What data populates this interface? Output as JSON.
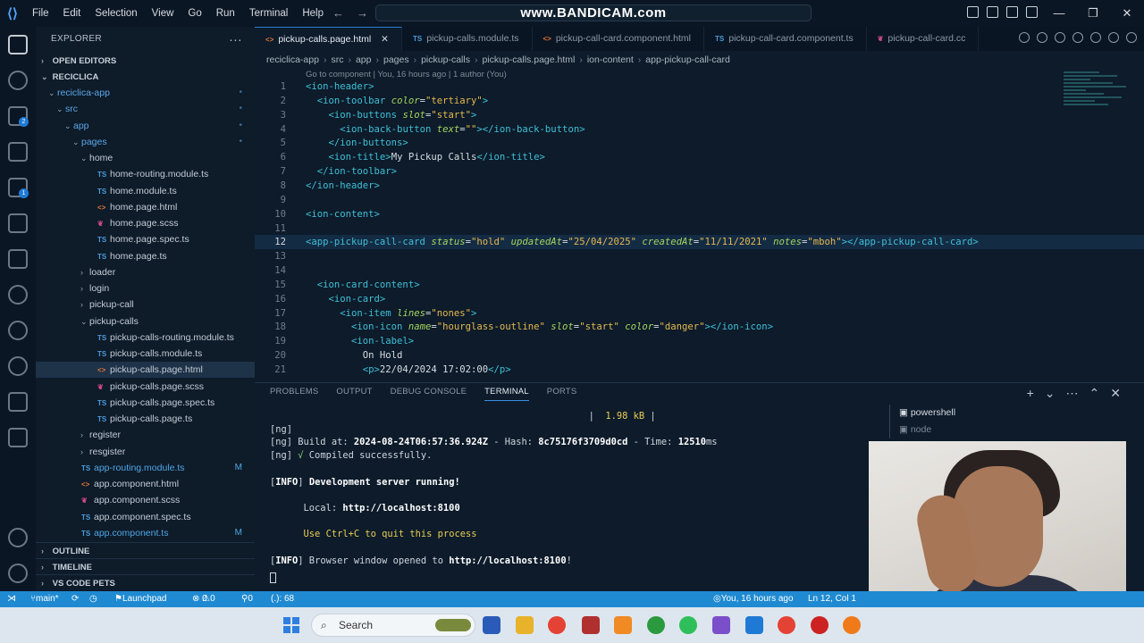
{
  "titlebar": {
    "menu": [
      "File",
      "Edit",
      "Selection",
      "View",
      "Go",
      "Run",
      "Terminal",
      "Help"
    ],
    "command_center": "www.BANDICAM.com",
    "window_controls": [
      "minimize-icon",
      "restore-icon",
      "close-icon"
    ]
  },
  "sidebar": {
    "title": "EXPLORER",
    "more": "···",
    "open_editors": "OPEN EDITORS",
    "project": "RECICLICA",
    "items": [
      {
        "label": "reciclica-app",
        "type": "folder",
        "open": true,
        "status": "•"
      },
      {
        "label": "src",
        "type": "folder",
        "open": true,
        "status": "•"
      },
      {
        "label": "app",
        "type": "folder",
        "open": true,
        "status": "•"
      },
      {
        "label": "pages",
        "type": "folder",
        "open": true,
        "status": "•"
      },
      {
        "label": "home",
        "type": "folder",
        "open": true,
        "status": ""
      },
      {
        "label": "home-routing.module.ts",
        "type": "ts",
        "status": ""
      },
      {
        "label": "home.module.ts",
        "type": "ts",
        "status": ""
      },
      {
        "label": "home.page.html",
        "type": "html",
        "status": ""
      },
      {
        "label": "home.page.scss",
        "type": "scss",
        "status": ""
      },
      {
        "label": "home.page.spec.ts",
        "type": "ts",
        "status": ""
      },
      {
        "label": "home.page.ts",
        "type": "ts",
        "status": ""
      },
      {
        "label": "loader",
        "type": "folder",
        "open": false,
        "status": ""
      },
      {
        "label": "login",
        "type": "folder",
        "open": false,
        "status": ""
      },
      {
        "label": "pickup-call",
        "type": "folder",
        "open": false,
        "status": ""
      },
      {
        "label": "pickup-calls",
        "type": "folder",
        "open": true,
        "status": ""
      },
      {
        "label": "pickup-calls-routing.module.ts",
        "type": "ts",
        "status": ""
      },
      {
        "label": "pickup-calls.module.ts",
        "type": "ts",
        "status": ""
      },
      {
        "label": "pickup-calls.page.html",
        "type": "html",
        "status": "",
        "selected": true
      },
      {
        "label": "pickup-calls.page.scss",
        "type": "scss",
        "status": ""
      },
      {
        "label": "pickup-calls.page.spec.ts",
        "type": "ts",
        "status": ""
      },
      {
        "label": "pickup-calls.page.ts",
        "type": "ts",
        "status": ""
      },
      {
        "label": "register",
        "type": "folder",
        "open": false,
        "status": ""
      },
      {
        "label": "resgister",
        "type": "folder",
        "open": false,
        "status": ""
      },
      {
        "label": "app-routing.module.ts",
        "type": "ts",
        "status": "M"
      },
      {
        "label": "app.component.html",
        "type": "html",
        "status": ""
      },
      {
        "label": "app.component.scss",
        "type": "scss",
        "status": ""
      },
      {
        "label": "app.component.spec.ts",
        "type": "ts",
        "status": ""
      },
      {
        "label": "app.component.ts",
        "type": "ts",
        "status": "M"
      }
    ],
    "outline": "OUTLINE",
    "timeline": "TIMELINE",
    "pets": "VS CODE PETS"
  },
  "tabs": [
    {
      "label": "pickup-calls.page.html",
      "icon": "<>",
      "active": true
    },
    {
      "label": "pickup-calls.module.ts",
      "icon": "TS",
      "active": false
    },
    {
      "label": "pickup-call-card.component.html",
      "icon": "<>",
      "active": false
    },
    {
      "label": "pickup-call-card.component.ts",
      "icon": "TS",
      "active": false
    },
    {
      "label": "pickup-call-card.cc",
      "icon": "scss",
      "active": false
    }
  ],
  "breadcrumb": [
    "reciclica-app",
    "src",
    "app",
    "pages",
    "pickup-calls",
    "pickup-calls.page.html",
    "ion-content",
    "app-pickup-call-card"
  ],
  "codelens": "Go to component | You, 16 hours ago | 1 author (You)",
  "code_lines": [
    {
      "n": "1",
      "t": [
        [
          "tg",
          "<ion-header>"
        ]
      ]
    },
    {
      "n": "2",
      "t": [
        [
          "pl",
          "  "
        ],
        [
          "tg",
          "<ion-toolbar "
        ],
        [
          "at",
          "color"
        ],
        [
          "pl",
          "="
        ],
        [
          "sv",
          "\"tertiary\""
        ],
        [
          "tg",
          ">"
        ]
      ]
    },
    {
      "n": "3",
      "t": [
        [
          "pl",
          "    "
        ],
        [
          "tg",
          "<ion-buttons "
        ],
        [
          "at",
          "slot"
        ],
        [
          "pl",
          "="
        ],
        [
          "sv",
          "\"start\""
        ],
        [
          "tg",
          ">"
        ]
      ]
    },
    {
      "n": "4",
      "t": [
        [
          "pl",
          "      "
        ],
        [
          "tg",
          "<ion-back-button "
        ],
        [
          "at",
          "text"
        ],
        [
          "pl",
          "="
        ],
        [
          "sv",
          "\"\""
        ],
        [
          "tg",
          "></ion-back-button>"
        ]
      ]
    },
    {
      "n": "5",
      "t": [
        [
          "pl",
          "    "
        ],
        [
          "tg",
          "</ion-buttons>"
        ]
      ]
    },
    {
      "n": "6",
      "t": [
        [
          "pl",
          "    "
        ],
        [
          "tg",
          "<ion-title>"
        ],
        [
          "pl",
          "My Pickup Calls"
        ],
        [
          "tg",
          "</ion-title>"
        ]
      ]
    },
    {
      "n": "7",
      "t": [
        [
          "pl",
          "  "
        ],
        [
          "tg",
          "</ion-toolbar>"
        ]
      ]
    },
    {
      "n": "8",
      "t": [
        [
          "tg",
          "</ion-header>"
        ]
      ]
    },
    {
      "n": "9",
      "t": []
    },
    {
      "n": "10",
      "t": [
        [
          "tg",
          "<ion-content>"
        ]
      ]
    },
    {
      "n": "11",
      "t": []
    },
    {
      "n": "12",
      "t": [
        [
          "tg",
          "<app-pickup-call-card "
        ],
        [
          "at",
          "status"
        ],
        [
          "pl",
          "="
        ],
        [
          "sv",
          "\"hold\" "
        ],
        [
          "at",
          "updatedAt"
        ],
        [
          "pl",
          "="
        ],
        [
          "sv",
          "\"25/04/2025\" "
        ],
        [
          "at",
          "createdAt"
        ],
        [
          "pl",
          "="
        ],
        [
          "sv",
          "\"11/11/2021\" "
        ],
        [
          "at",
          "notes"
        ],
        [
          "pl",
          "="
        ],
        [
          "sv",
          "\"mboh\""
        ],
        [
          "tg",
          "></app-pickup-call-card>"
        ]
      ],
      "cur": true,
      "blame": "You, 16"
    },
    {
      "n": "13",
      "t": []
    },
    {
      "n": "14",
      "t": []
    },
    {
      "n": "15",
      "t": [
        [
          "pl",
          "  "
        ],
        [
          "tg",
          "<ion-card-content>"
        ]
      ]
    },
    {
      "n": "16",
      "t": [
        [
          "pl",
          "    "
        ],
        [
          "tg",
          "<ion-card>"
        ]
      ]
    },
    {
      "n": "17",
      "t": [
        [
          "pl",
          "      "
        ],
        [
          "tg",
          "<ion-item "
        ],
        [
          "at",
          "lines"
        ],
        [
          "pl",
          "="
        ],
        [
          "sv",
          "\"nones\""
        ],
        [
          "tg",
          ">"
        ]
      ]
    },
    {
      "n": "18",
      "t": [
        [
          "pl",
          "        "
        ],
        [
          "tg",
          "<ion-icon "
        ],
        [
          "at",
          "name"
        ],
        [
          "pl",
          "="
        ],
        [
          "sv",
          "\"hourglass-outline\" "
        ],
        [
          "at",
          "slot"
        ],
        [
          "pl",
          "="
        ],
        [
          "sv",
          "\"start\" "
        ],
        [
          "at",
          "color"
        ],
        [
          "pl",
          "="
        ],
        [
          "sv",
          "\"danger\""
        ],
        [
          "tg",
          "></ion-icon>"
        ]
      ]
    },
    {
      "n": "19",
      "t": [
        [
          "pl",
          "        "
        ],
        [
          "tg",
          "<ion-label>"
        ]
      ]
    },
    {
      "n": "20",
      "t": [
        [
          "pl",
          "          On Hold"
        ]
      ]
    },
    {
      "n": "21",
      "t": [
        [
          "pl",
          "          "
        ],
        [
          "tg",
          "<p>"
        ],
        [
          "pl",
          "22/04/2024 17:02:00"
        ],
        [
          "tg",
          "</p>"
        ]
      ]
    }
  ],
  "panel": {
    "tabs": [
      "PROBLEMS",
      "OUTPUT",
      "DEBUG CONSOLE",
      "TERMINAL",
      "PORTS"
    ],
    "active_tab": "TERMINAL",
    "terminal_lines": [
      [
        [
          "n",
          "                                                         |  "
        ],
        [
          "tgy",
          "1.98 kB"
        ],
        [
          "n",
          " |"
        ]
      ],
      [
        [
          "n",
          "[ng]"
        ]
      ],
      [
        [
          "n",
          "[ng] Build at: "
        ],
        [
          "tb",
          "2024-08-24T06:57:36.924Z"
        ],
        [
          "n",
          " - Hash: "
        ],
        [
          "tb",
          "8c75176f3709d0cd"
        ],
        [
          "n",
          " - Time: "
        ],
        [
          "tb",
          "12510"
        ],
        [
          "n",
          "ms"
        ]
      ],
      [
        [
          "n",
          "[ng] "
        ],
        [
          "tgr",
          "√"
        ],
        [
          "n",
          " Compiled successfully."
        ]
      ],
      [
        [
          "n",
          ""
        ]
      ],
      [
        [
          "n",
          "["
        ],
        [
          "tb",
          "INFO"
        ],
        [
          "n",
          "] "
        ],
        [
          "tb",
          "Development server running!"
        ]
      ],
      [
        [
          "n",
          ""
        ]
      ],
      [
        [
          "n",
          "      Local: "
        ],
        [
          "tb",
          "http://localhost:8100"
        ]
      ],
      [
        [
          "n",
          ""
        ]
      ],
      [
        [
          "n",
          "      "
        ],
        [
          "tgy",
          "Use Ctrl+C to quit this process"
        ]
      ],
      [
        [
          "n",
          ""
        ]
      ],
      [
        [
          "n",
          "["
        ],
        [
          "tb",
          "INFO"
        ],
        [
          "n",
          "] Browser window opened to "
        ],
        [
          "tb",
          "http://localhost:8100"
        ],
        [
          "n",
          "!"
        ]
      ]
    ],
    "terminal_list": [
      {
        "label": "powershell",
        "dim": false
      },
      {
        "label": "node",
        "dim": true
      }
    ]
  },
  "statusbar": {
    "branch": "main*",
    "launchpad": "Launchpad",
    "errors": "0",
    "warnings": "0",
    "ports": "0",
    "cursor_info": "(.): 68",
    "blame": "You, 16 hours ago",
    "position": "Ln 12, Col 1"
  },
  "taskbar": {
    "search": "Search"
  },
  "colors": {
    "accent": "#1f8ad1",
    "editor_bg": "#0d1b2a"
  }
}
